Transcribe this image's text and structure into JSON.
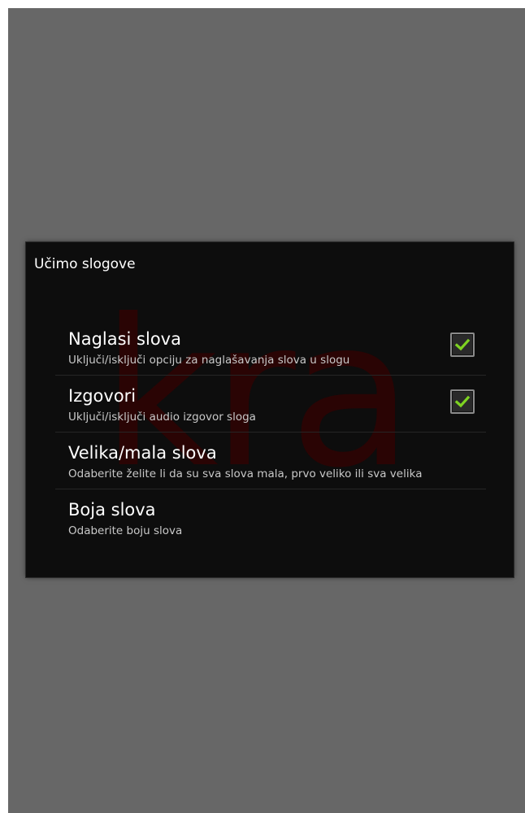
{
  "dialog": {
    "title": "Učimo slogove",
    "watermark": "kra"
  },
  "preferences": [
    {
      "title": "Naglasi slova",
      "summary": "Uključi/isključi opciju za naglašavanja slova u slogu",
      "checked": true
    },
    {
      "title": "Izgovori",
      "summary": "Uključi/isključi audio izgovor sloga",
      "checked": true
    },
    {
      "title": "Velika/mala slova",
      "summary": "Odaberite želite li da su sva slova mala, prvo veliko ili sva velika"
    },
    {
      "title": "Boja slova",
      "summary": "Odaberite boju slova"
    }
  ],
  "colors": {
    "screen_background": "#676767",
    "dialog_background": "#0d0d0d",
    "check_accent": "#7ed321"
  },
  "icons": {
    "checkbox_check": "check-icon"
  }
}
